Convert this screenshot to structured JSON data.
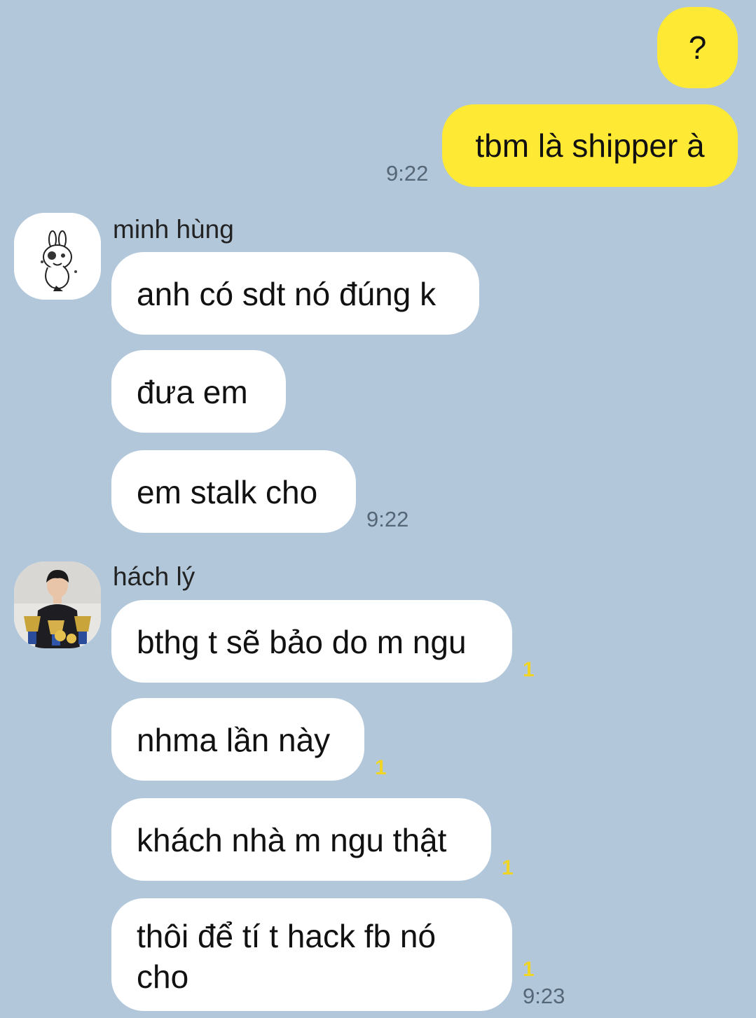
{
  "outgoing": [
    {
      "text": "?"
    },
    {
      "text": "tbm là shipper à",
      "time": "9:22"
    }
  ],
  "groups": [
    {
      "sender": "minh hùng",
      "avatar_icon": "bunny-sticker-avatar",
      "messages": [
        {
          "text": "anh có sdt nó đúng k"
        },
        {
          "text": "đưa em"
        },
        {
          "text": "em stalk cho",
          "time": "9:22"
        }
      ]
    },
    {
      "sender": "hách lý",
      "avatar_icon": "trophies-person-avatar",
      "messages": [
        {
          "text": "bthg t sẽ bảo do m ngu",
          "unread": "1"
        },
        {
          "text": "nhma lần này",
          "unread": "1"
        },
        {
          "text": "khách nhà m ngu thật",
          "unread": "1"
        },
        {
          "text": "thôi để tí t hack fb nó cho",
          "unread": "1",
          "time": "9:23"
        }
      ]
    }
  ],
  "colors": {
    "background": "#b2c7da",
    "outgoing_bubble": "#fee934",
    "incoming_bubble": "#ffffff",
    "unread_count": "#f0d526"
  }
}
